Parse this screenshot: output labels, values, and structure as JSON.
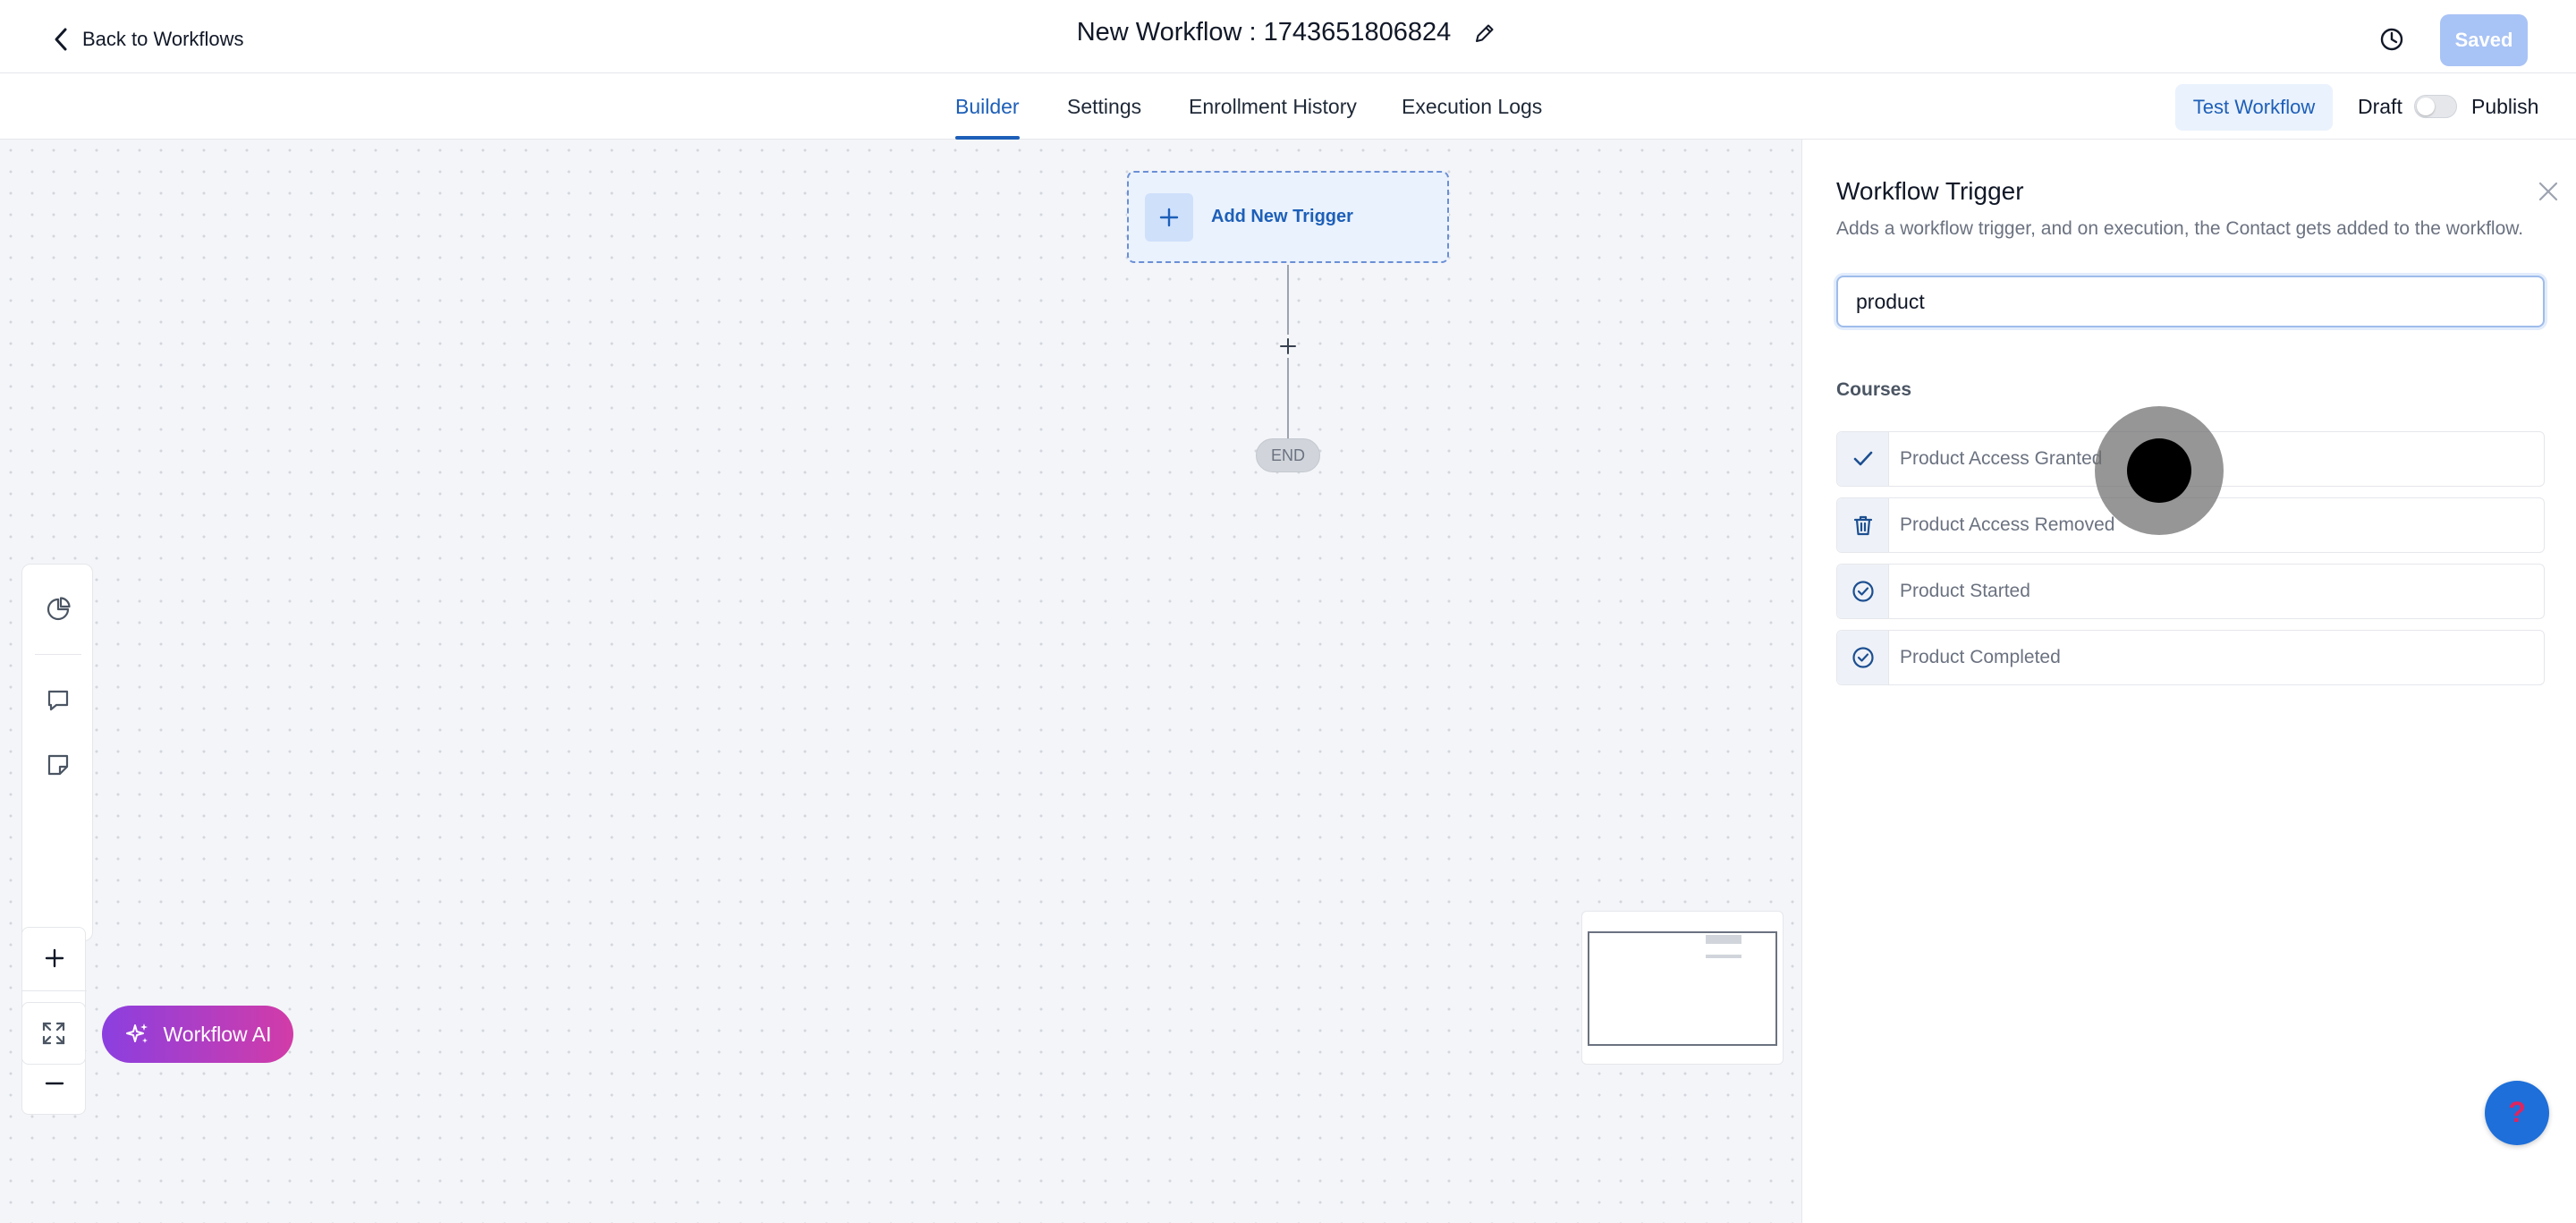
{
  "header": {
    "back_label": "Back to Workflows",
    "title": "New Workflow : 1743651806824",
    "saved_label": "Saved"
  },
  "tabs": [
    {
      "label": "Builder",
      "active": true
    },
    {
      "label": "Settings",
      "active": false
    },
    {
      "label": "Enrollment History",
      "active": false
    },
    {
      "label": "Execution Logs",
      "active": false
    }
  ],
  "actions": {
    "test_label": "Test Workflow",
    "draft_label": "Draft",
    "publish_label": "Publish",
    "published": false
  },
  "canvas": {
    "trigger_label": "Add New Trigger",
    "end_label": "END",
    "zoom_level": "100%",
    "ai_label": "Workflow AI"
  },
  "panel": {
    "title": "Workflow Trigger",
    "description": "Adds a workflow trigger, and on execution, the Contact gets added to the workflow.",
    "search_value": "product",
    "section_label": "Courses",
    "options": [
      {
        "label": "Product Access Granted",
        "icon": "check-icon"
      },
      {
        "label": "Product Access Removed",
        "icon": "trash-icon"
      },
      {
        "label": "Product Started",
        "icon": "check-circle-icon"
      },
      {
        "label": "Product Completed",
        "icon": "check-circle-icon"
      }
    ]
  },
  "help_symbol": "?",
  "colors": {
    "accent": "#1d5fb8",
    "saved_button": "#a8c3f5",
    "ai_gradient_start": "#8b3fe0",
    "ai_gradient_end": "#d23ca8",
    "help_button": "#1e6fd9"
  }
}
